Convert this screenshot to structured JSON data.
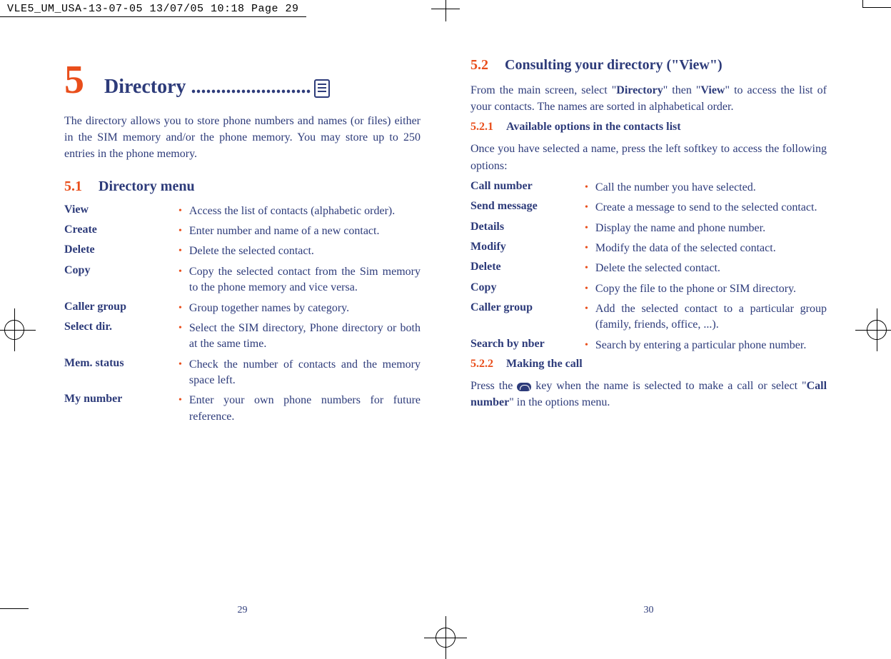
{
  "header_slug": "VLE5_UM_USA-13-07-05  13/07/05  10:18  Page 29",
  "left": {
    "chapter_number": "5",
    "chapter_title": "Directory ........................",
    "intro": "The directory allows you to store phone numbers and names (or files) either in the SIM memory and/or the phone memory. You may store up to 250 entries in the phone memory.",
    "sec_num": "5.1",
    "sec_title": "Directory menu",
    "items": [
      {
        "term": "View",
        "desc": "Access the list of contacts (alphabetic order)."
      },
      {
        "term": "Create",
        "desc": "Enter number and name of a new contact."
      },
      {
        "term": "Delete",
        "desc": "Delete the selected contact."
      },
      {
        "term": "Copy",
        "desc": "Copy the selected contact from the Sim memory to the phone memory and vice versa."
      },
      {
        "term": "Caller group",
        "desc": "Group together names by category."
      },
      {
        "term": "Select dir.",
        "desc": "Select the SIM directory, Phone directory or both at the same time."
      },
      {
        "term": "Mem. status",
        "desc": "Check the number of contacts and the memory space left."
      },
      {
        "term": "My number",
        "desc": "Enter your own phone numbers for future reference."
      }
    ],
    "page_num": "29"
  },
  "right": {
    "sec_num": "5.2",
    "sec_title": "Consulting your directory (\"View\")",
    "intro_a": "From the main screen, select \"",
    "intro_b": "Directory",
    "intro_c": "\" then \"",
    "intro_d": "View",
    "intro_e": "\" to access the list of your contacts. The names are sorted in alphabetical order.",
    "sub1_num": "5.2.1",
    "sub1_title": "Available options in the contacts list",
    "sub1_lead": "Once you have selected a name, press the left softkey to access the following options:",
    "items": [
      {
        "term": "Call number",
        "desc": "Call the number you have selected."
      },
      {
        "term": "Send message",
        "desc": "Create a message to send to the selected contact."
      },
      {
        "term": "Details",
        "desc": "Display the name and phone number."
      },
      {
        "term": "Modify",
        "desc": "Modify the data of the selected contact."
      },
      {
        "term": "Delete",
        "desc": "Delete the selected contact."
      },
      {
        "term": "Copy",
        "desc": "Copy the file to the phone or SIM directory."
      },
      {
        "term": "Caller group",
        "desc": "Add the selected contact to a particular group (family, friends, office, ...)."
      },
      {
        "term": "Search by nber",
        "desc": "Search by entering a particular phone number."
      }
    ],
    "sub2_num": "5.2.2",
    "sub2_title": "Making the call",
    "call_a": "Press the ",
    "call_b": " key when the name is selected to make a call or select \"",
    "call_c": "Call number",
    "call_d": "\" in the options menu.",
    "page_num": "30"
  }
}
